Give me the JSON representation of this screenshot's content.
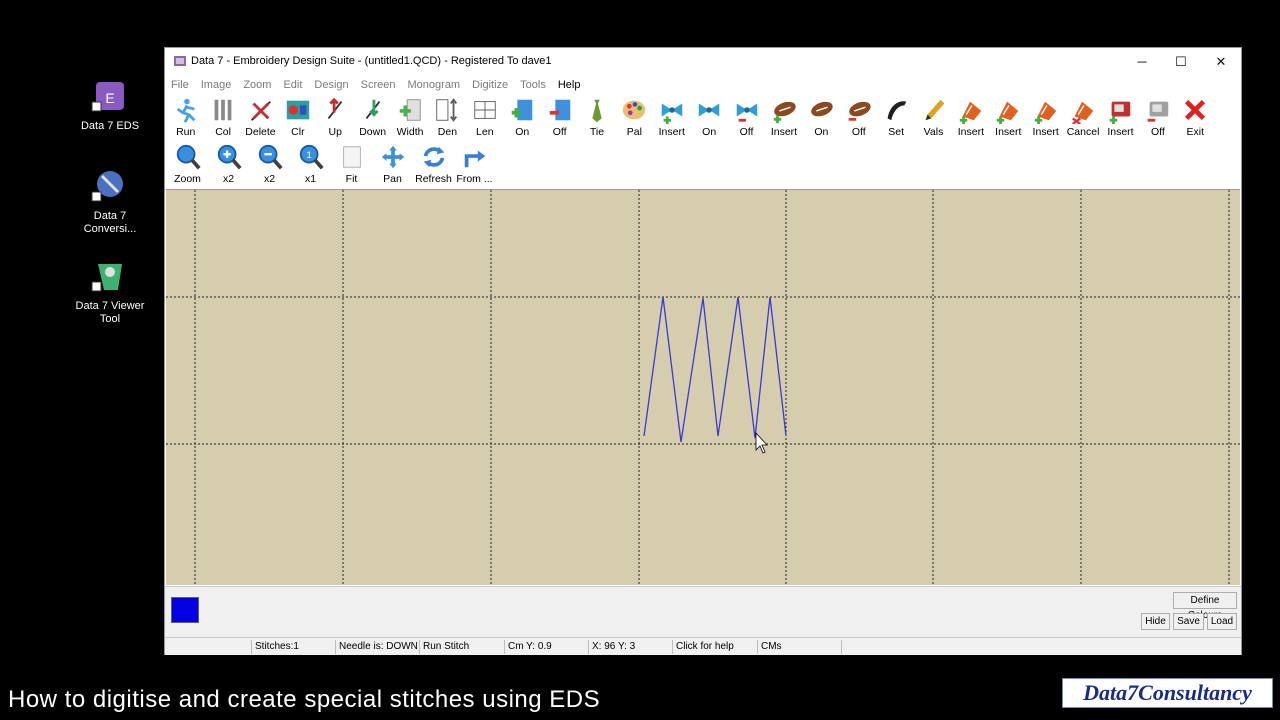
{
  "desktop": {
    "icons": [
      {
        "label": "Data 7 EDS",
        "icon": "eds-icon"
      },
      {
        "label": "Data 7 Conversi...",
        "icon": "conversion-icon"
      },
      {
        "label": "Data 7 Viewer Tool",
        "icon": "viewer-icon"
      }
    ]
  },
  "window": {
    "title": "Data 7 - Embroidery Design Suite - (untitled1.QCD) - Registered To dave1",
    "controls": {
      "minimize": "─",
      "maximize": "☐",
      "close": "✕"
    }
  },
  "menu": [
    "File",
    "Image",
    "Zoom",
    "Edit",
    "Design",
    "Screen",
    "Monogram",
    "Digitize",
    "Tools",
    "Help"
  ],
  "toolbar_row1": [
    {
      "label": "Run",
      "icon": "run-icon",
      "color": "#4aa0e0"
    },
    {
      "label": "Col",
      "icon": "column-icon",
      "color": "#8a8a8a"
    },
    {
      "label": "Delete",
      "icon": "delete-icon",
      "color": "#c03030"
    },
    {
      "label": "Clr",
      "icon": "clear-icon",
      "color": "#30a0a0"
    },
    {
      "label": "Up",
      "icon": "up-icon",
      "color": "#c03030"
    },
    {
      "label": "Down",
      "icon": "down-icon",
      "color": "#30a060"
    },
    {
      "label": "Width",
      "icon": "width-icon",
      "color": "#50b050"
    },
    {
      "label": "Den",
      "icon": "density-icon",
      "color": "#606060"
    },
    {
      "label": "Len",
      "icon": "length-icon",
      "color": "#606060"
    },
    {
      "label": "On",
      "icon": "on-icon",
      "color": "#3080d0"
    },
    {
      "label": "Off",
      "icon": "off-icon",
      "color": "#3080d0"
    },
    {
      "label": "Tie",
      "icon": "tie-icon",
      "color": "#6a9a30"
    },
    {
      "label": "Pal",
      "icon": "palette-icon",
      "color": "#e0a030"
    },
    {
      "label": "Insert",
      "icon": "bow-insert-icon",
      "color": "#30a0d0"
    },
    {
      "label": "On",
      "icon": "bow-on-icon",
      "color": "#30a0d0"
    },
    {
      "label": "Off",
      "icon": "bow-off-icon",
      "color": "#30a0d0"
    },
    {
      "label": "Insert",
      "icon": "football-insert-icon",
      "color": "#8a4a20"
    },
    {
      "label": "On",
      "icon": "football-on-icon",
      "color": "#8a4a20"
    },
    {
      "label": "Off",
      "icon": "football-off-icon",
      "color": "#8a4a20"
    },
    {
      "label": "Set",
      "icon": "set-icon",
      "color": "#202020"
    },
    {
      "label": "Vals",
      "icon": "pencil-icon",
      "color": "#e0a020"
    },
    {
      "label": "Insert",
      "icon": "shape-insert-icon",
      "color": "#e06020"
    },
    {
      "label": "Insert",
      "icon": "shape-insert-b-icon",
      "color": "#e06020"
    },
    {
      "label": "Insert",
      "icon": "shape-insert-c-icon",
      "color": "#e06020"
    },
    {
      "label": "Cancel",
      "icon": "cancel-shape-icon",
      "color": "#e06020"
    },
    {
      "label": "Insert",
      "icon": "machine-insert-icon",
      "color": "#c03030"
    },
    {
      "label": "Off",
      "icon": "machine-off-icon",
      "color": "#a0a0a0"
    },
    {
      "label": "Exit",
      "icon": "exit-icon",
      "color": "#e02020"
    }
  ],
  "toolbar_row2": [
    {
      "label": "Zoom",
      "icon": "zoom-icon"
    },
    {
      "label": "x2",
      "icon": "zoom-in-icon"
    },
    {
      "label": "x2",
      "icon": "zoom-out-icon"
    },
    {
      "label": "x1",
      "icon": "zoom-reset-icon"
    },
    {
      "label": "Fit",
      "icon": "fit-icon"
    },
    {
      "label": "Pan",
      "icon": "pan-icon"
    },
    {
      "label": "Refresh",
      "icon": "refresh-icon"
    },
    {
      "label": "From ...",
      "icon": "from-icon"
    }
  ],
  "canvas": {
    "background": "#d6cdae",
    "stitch_color": "#3a3ad0",
    "stitch_points": [
      [
        478,
        246
      ],
      [
        497,
        107
      ],
      [
        515,
        252
      ],
      [
        537,
        108
      ],
      [
        552,
        246
      ],
      [
        572,
        107
      ],
      [
        589,
        248
      ],
      [
        604,
        107
      ],
      [
        620,
        246
      ]
    ]
  },
  "colorbar": {
    "swatch_color": "#0000e0",
    "define_colours": "Define Colours",
    "hide": "Hide",
    "save": "Save",
    "load": "Load"
  },
  "status": {
    "stitches": "Stitches:1",
    "needle": "Needle is: DOWN",
    "mode": "Run Stitch",
    "cm": "Cm Y: 0.9",
    "xy": "X: 96 Y: 3",
    "help": "Click for help",
    "units": "CMs"
  },
  "caption": "How to digitise and create special stitches using EDS",
  "logo": "Data7Consultancy"
}
